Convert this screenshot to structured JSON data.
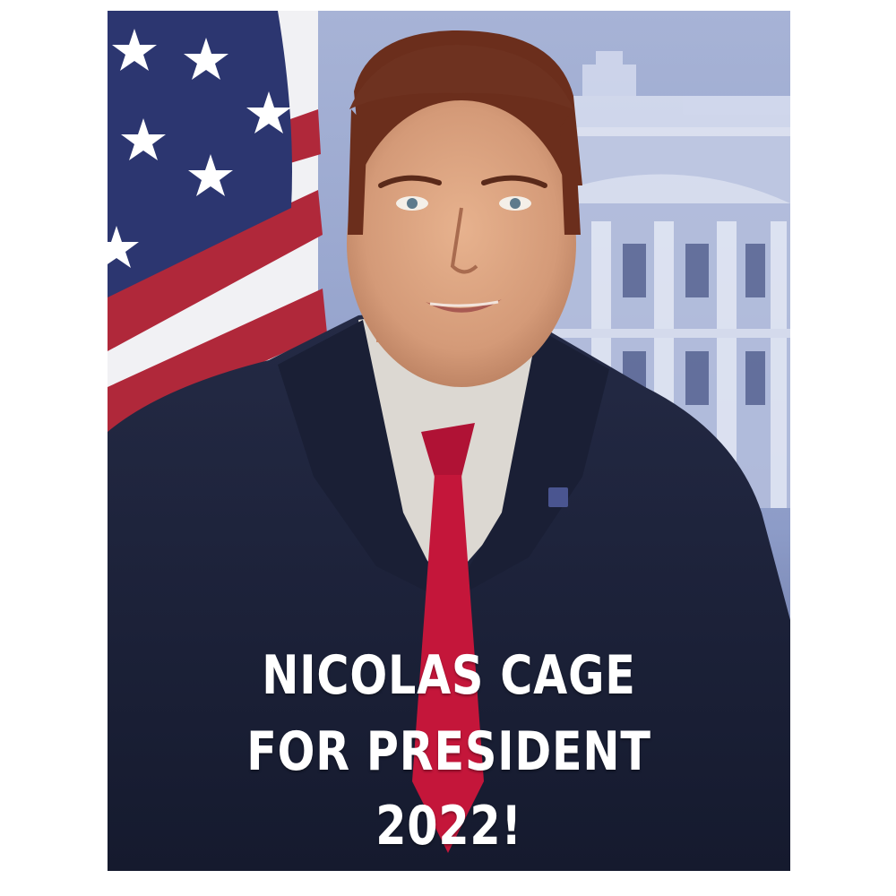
{
  "poster": {
    "caption_lines": [
      "NICOLAS CAGE",
      "FOR PRESIDENT",
      "2022!"
    ]
  },
  "colors": {
    "background": "#ffffff",
    "caption": "#ffffff",
    "suit": "#1c2036",
    "tie": "#c4163a",
    "shirt": "#dcd8d2",
    "flag_blue": "#2c3670",
    "flag_red": "#b0283a",
    "building": "#c9d1e8"
  },
  "icons": {
    "flag": "american-flag",
    "building": "white-house",
    "pin": "flag-lapel-pin"
  }
}
